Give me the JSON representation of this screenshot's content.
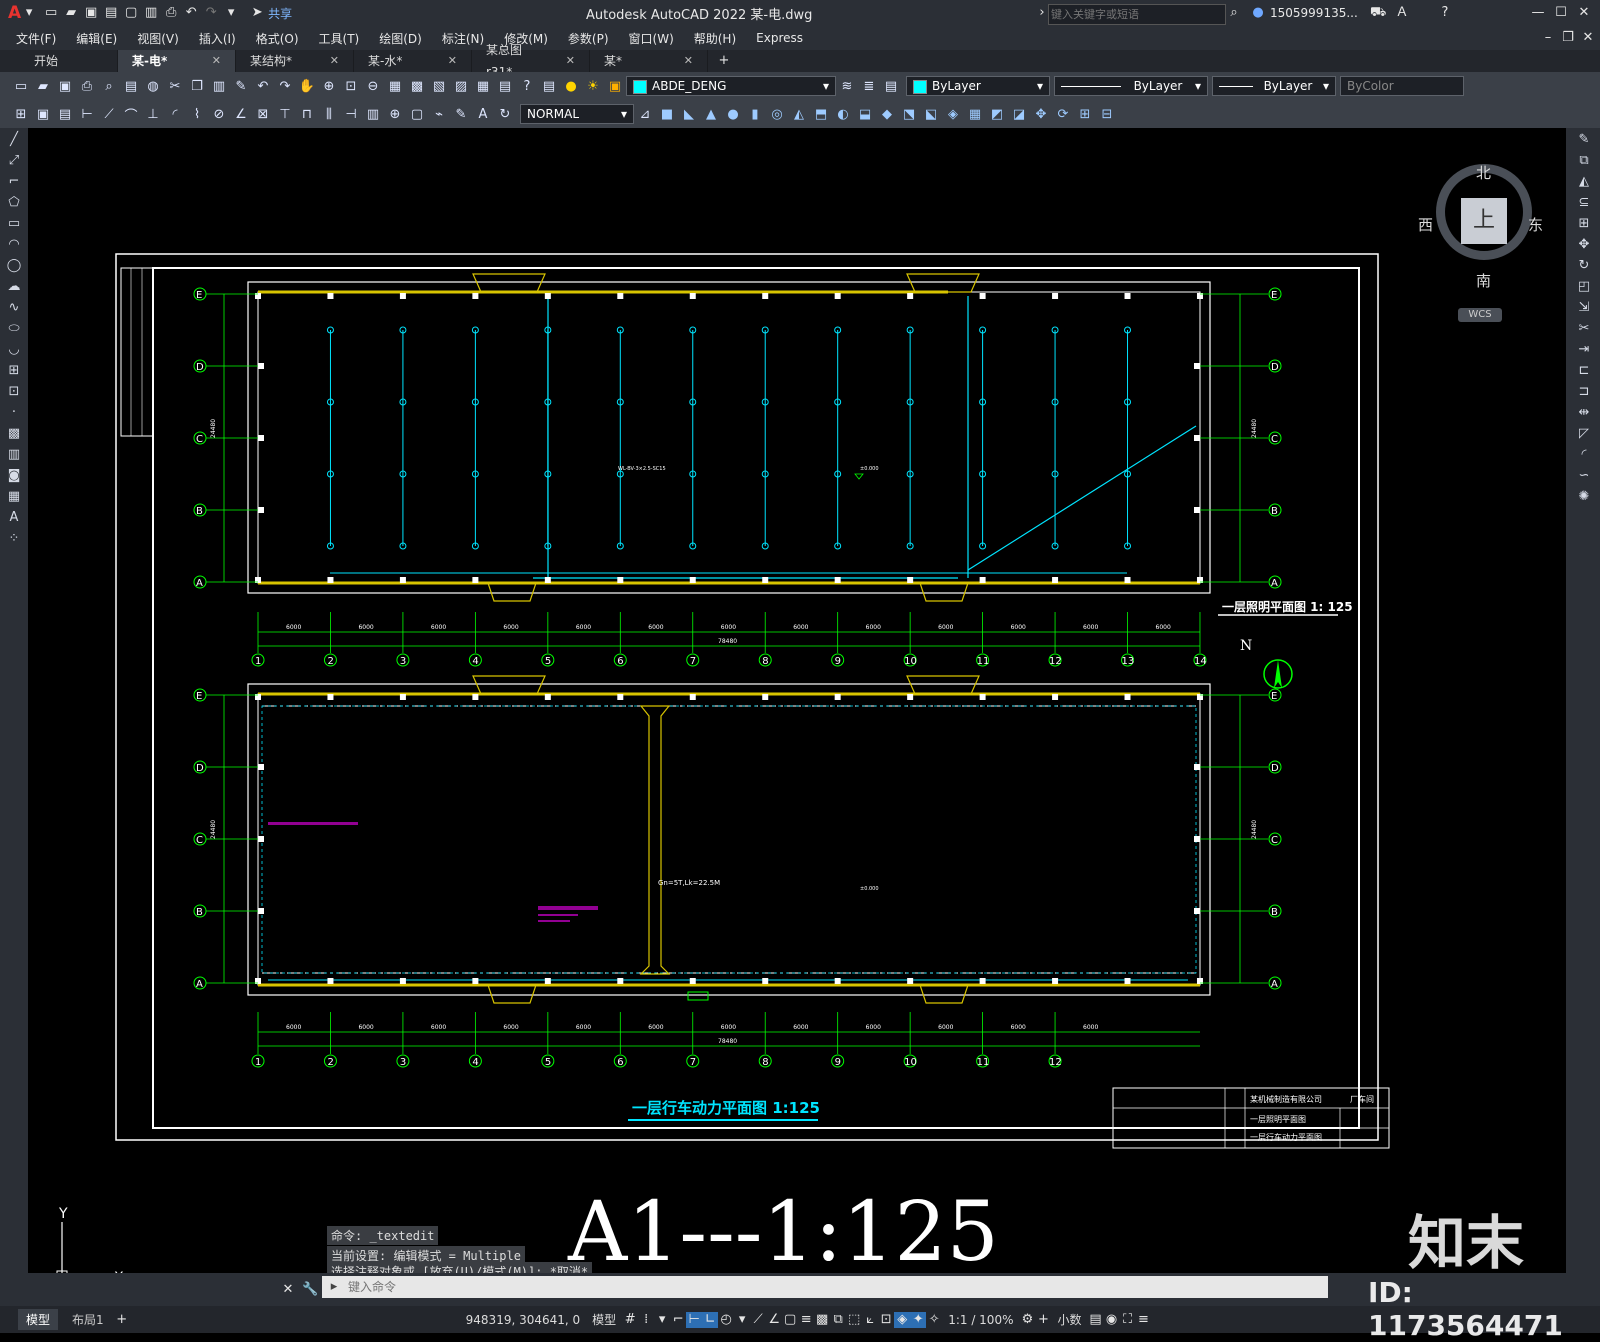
{
  "app": {
    "title": "Autodesk AutoCAD 2022  某-电.dwg",
    "share_label": "共享",
    "search_placeholder": "键入关键字或短语",
    "user": "1505999135...",
    "logo": "A"
  },
  "menu": [
    "文件(F)",
    "编辑(E)",
    "视图(V)",
    "插入(I)",
    "格式(O)",
    "工具(T)",
    "绘图(D)",
    "标注(N)",
    "修改(M)",
    "参数(P)",
    "窗口(W)",
    "帮助(H)",
    "Express"
  ],
  "tabs": [
    {
      "label": "开始"
    },
    {
      "label": "某-电*",
      "active": true
    },
    {
      "label": "某结构*"
    },
    {
      "label": "某-水*"
    },
    {
      "label": "某总图r31*"
    },
    {
      "label": "某*"
    }
  ],
  "toolbar": {
    "layer_name": "ABDE_DENG",
    "layer_color": "#00ffff",
    "color_value": "ByLayer",
    "linetype_value": "ByLayer",
    "lineweight_value": "ByLayer",
    "plotstyle_value": "ByColor",
    "textstyle_value": "NORMAL"
  },
  "viewcube": {
    "north": "北",
    "south": "南",
    "east": "东",
    "west": "西",
    "face": "上",
    "wcs": "WCS"
  },
  "drawing": {
    "plan1_title": "一层照明平面图 1: 125",
    "plan2_title": "一层行车动力平面图 1:125",
    "north_label": "N",
    "row_axes": [
      "E",
      "D",
      "C",
      "B",
      "A"
    ],
    "col_axes": [
      "1",
      "2",
      "3",
      "4",
      "5",
      "6",
      "7",
      "8",
      "9",
      "10",
      "11",
      "12",
      "13",
      "14"
    ],
    "span_labels": [
      "6000",
      "6000",
      "6000",
      "6000",
      "6000",
      "6000",
      "6000",
      "6000",
      "6000",
      "6000",
      "6000",
      "6000",
      "6000"
    ],
    "total_length": "78480",
    "total_width": "24480",
    "crane_label": "Gn=5T,Lk=22.5M",
    "elevation": "±0.000",
    "scale_banner": "A1---1:125",
    "title_block": {
      "company": "某机械制造有限公司",
      "project": "厂车间",
      "drawing1": "一层照明平面图",
      "drawing2": "一层行车动力平面图"
    }
  },
  "command": {
    "history": [
      "命令: _textedit",
      "当前设置: 编辑模式 = Multiple",
      "选择注释对象或 [放弃(U)/模式(M)]: *取消*"
    ],
    "placeholder": "键入命令"
  },
  "status": {
    "coords": "948319, 304641, 0",
    "mode": "模型",
    "scale": "1:1 / 100%",
    "units": "小数"
  },
  "layouts": [
    {
      "label": "模型",
      "active": true
    },
    {
      "label": "布局1"
    }
  ],
  "watermark": {
    "brand": "知末",
    "id": "ID: 1173564471"
  }
}
